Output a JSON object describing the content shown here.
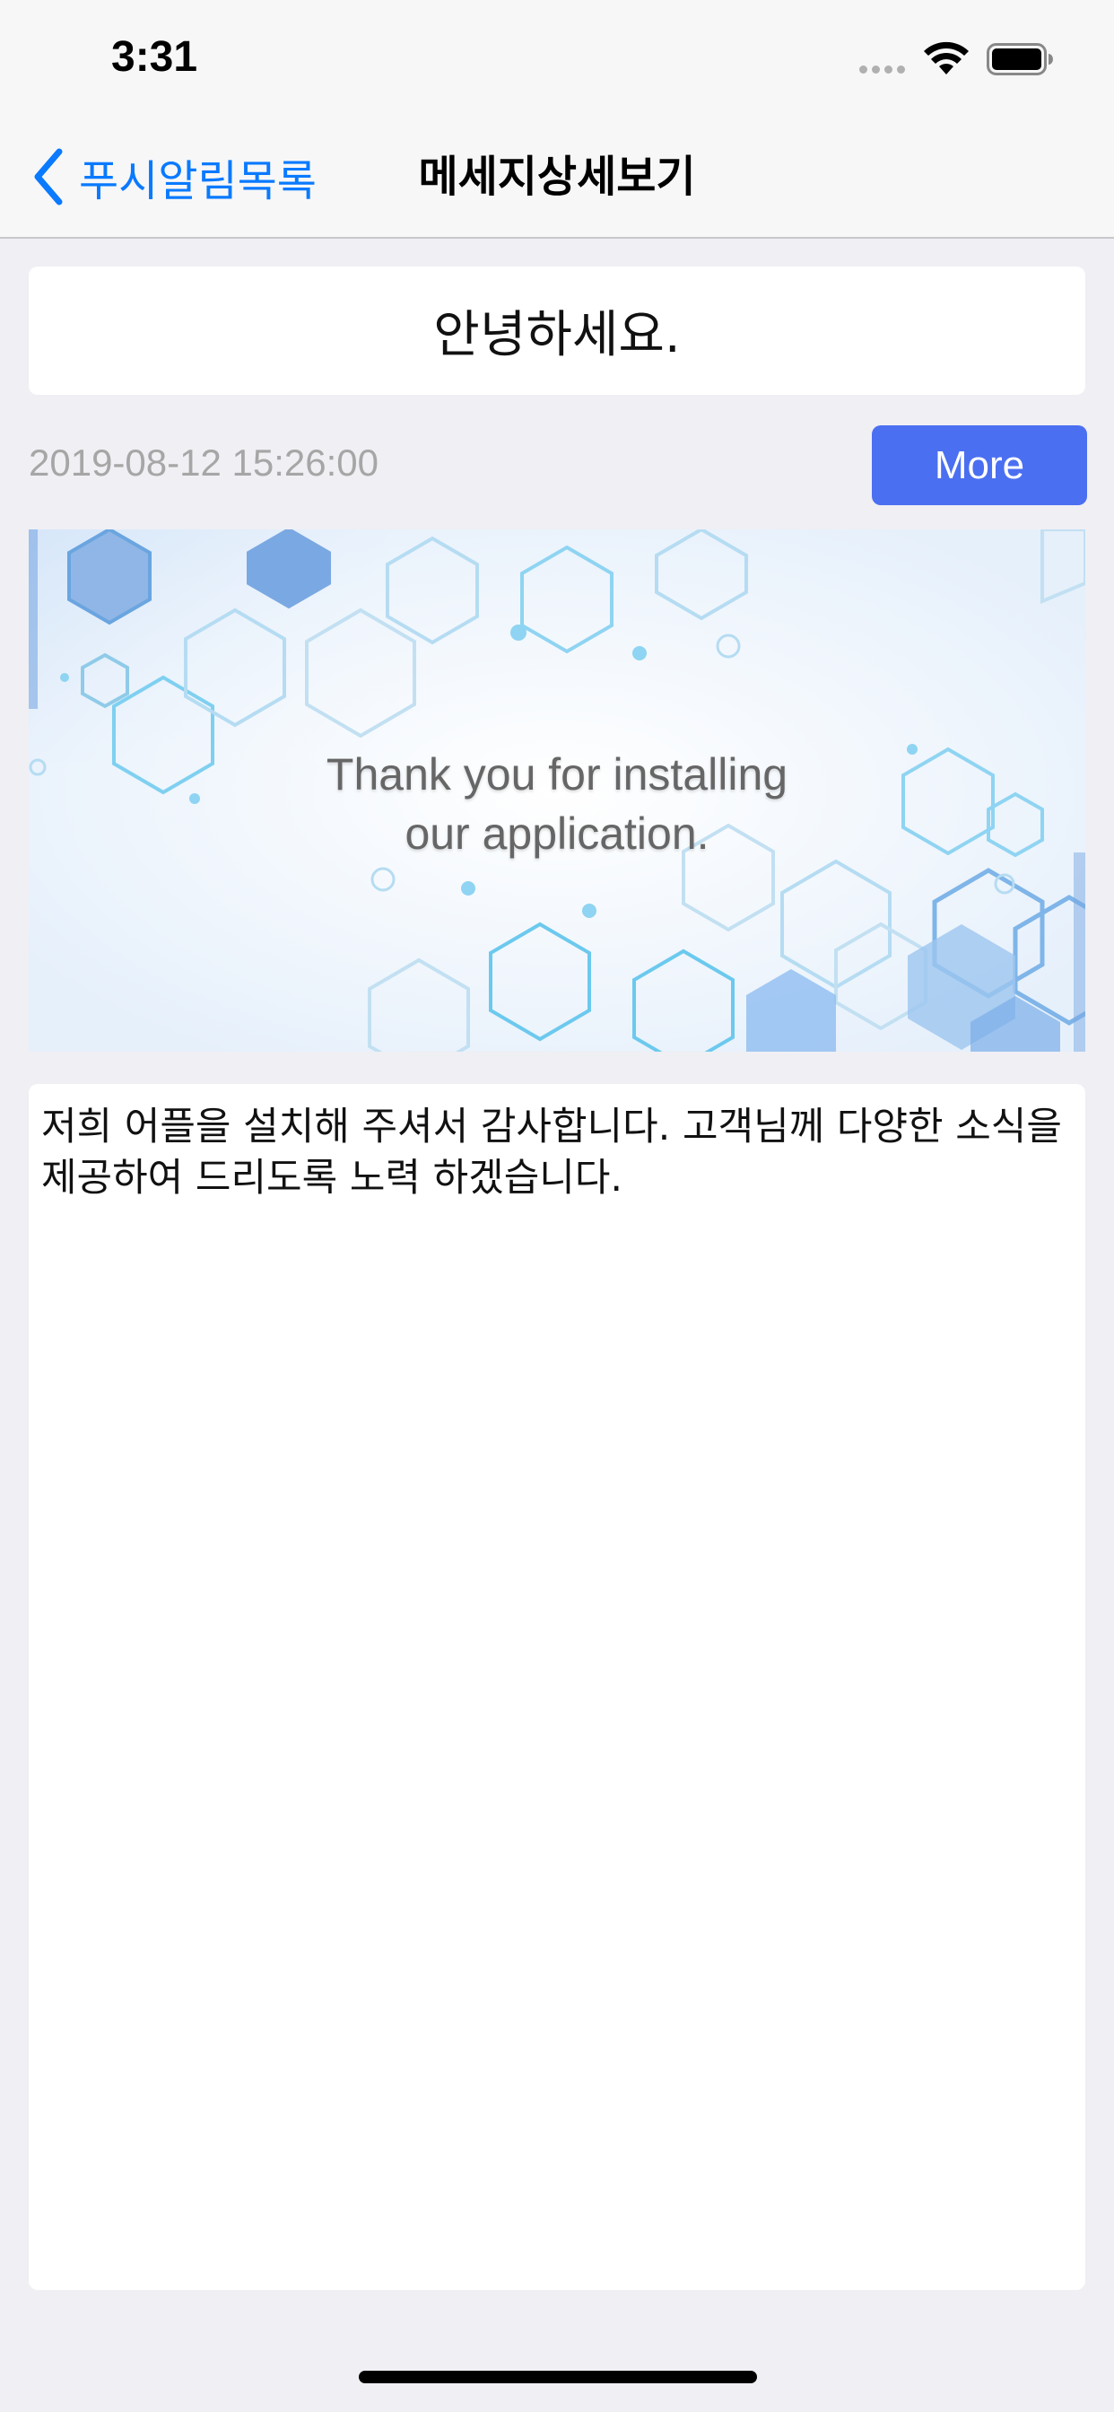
{
  "status_bar": {
    "time": "3:31",
    "icons": [
      "signal-icon",
      "wifi-icon",
      "battery-icon"
    ]
  },
  "nav": {
    "back_label": "푸시알림목록",
    "title": "메세지상세보기",
    "back_icon": "chevron-left-icon"
  },
  "message": {
    "title": "안녕하세요.",
    "date": "2019-08-12 15:26:00",
    "more_label": "More",
    "banner_lines": [
      "Thank you for installing",
      "our application."
    ],
    "body": "저희 어플을 설치해 주셔서 감사합니다. 고객님께 다양한 소식을 제공하여 드리도록 노력 하겠습니다."
  },
  "colors": {
    "accent": "#0a7aff",
    "more_button": "#4b6ff1",
    "background": "#efeff4",
    "date_text": "#a6a6a6"
  }
}
